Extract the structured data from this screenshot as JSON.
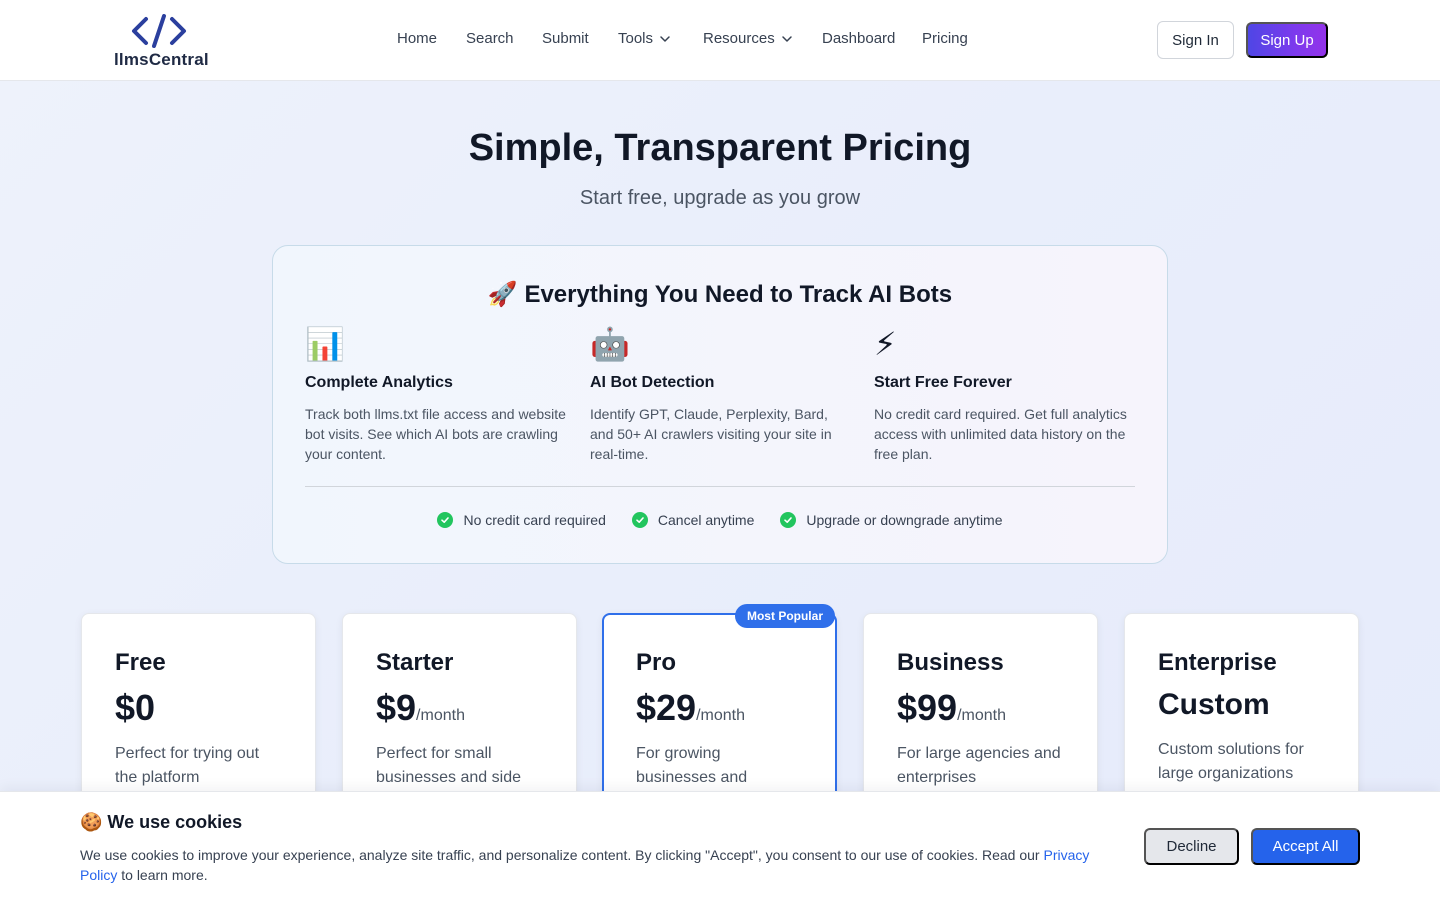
{
  "brand": {
    "name": "llmsCentral",
    "logo_icon": "code-brackets-icon"
  },
  "nav": {
    "items": [
      {
        "label": "Home"
      },
      {
        "label": "Search"
      },
      {
        "label": "Submit"
      },
      {
        "label": "Tools",
        "has_dropdown": true
      },
      {
        "label": "Resources",
        "has_dropdown": true
      },
      {
        "label": "Dashboard"
      },
      {
        "label": "Pricing"
      }
    ],
    "signin_label": "Sign In",
    "signup_label": "Sign Up"
  },
  "hero": {
    "title": "Simple, Transparent Pricing",
    "subtitle": "Start free, upgrade as you grow"
  },
  "features": {
    "title": "🚀 Everything You Need to Track AI Bots",
    "items": [
      {
        "icon": "📊",
        "icon_name": "bar-chart-icon",
        "title": "Complete Analytics",
        "description": "Track both llms.txt file access and website bot visits. See which AI bots are crawling your content."
      },
      {
        "icon": "🤖",
        "icon_name": "robot-icon",
        "title": "AI Bot Detection",
        "description": "Identify GPT, Claude, Perplexity, Bard, and 50+ AI crawlers visiting your site in real-time."
      },
      {
        "icon": "⚡",
        "icon_name": "lightning-icon",
        "title": "Start Free Forever",
        "description": "No credit card required. Get full analytics access with unlimited data history on the free plan."
      }
    ],
    "checks": [
      "No credit card required",
      "Cancel anytime",
      "Upgrade or downgrade anytime"
    ]
  },
  "plans": [
    {
      "name": "Free",
      "price": "$0",
      "period": "",
      "description": "Perfect for trying out the platform"
    },
    {
      "name": "Starter",
      "price": "$9",
      "period": "/month",
      "description": "Perfect for small businesses and side"
    },
    {
      "name": "Pro",
      "price": "$29",
      "period": "/month",
      "description": "For growing businesses and",
      "badge": "Most Popular"
    },
    {
      "name": "Business",
      "price": "$99",
      "period": "/month",
      "description": "For large agencies and enterprises"
    },
    {
      "name": "Enterprise",
      "price": "Custom",
      "period": "",
      "description": "Custom solutions for large organizations"
    }
  ],
  "cookie": {
    "title": "🍪 We use cookies",
    "text": "We use cookies to improve your experience, analyze site traffic, and personalize content. By clicking \"Accept\", you consent to our use of cookies. Read our ",
    "link_label": "Privacy Policy",
    "text_after": " to learn more.",
    "decline_label": "Decline",
    "accept_label": "Accept All"
  },
  "colors": {
    "accent": "#2563eb",
    "popular_border": "#2f6fea",
    "signup_gradient_start": "#4f46e5",
    "signup_gradient_end": "#9333ea",
    "check_green": "#22c55e"
  }
}
